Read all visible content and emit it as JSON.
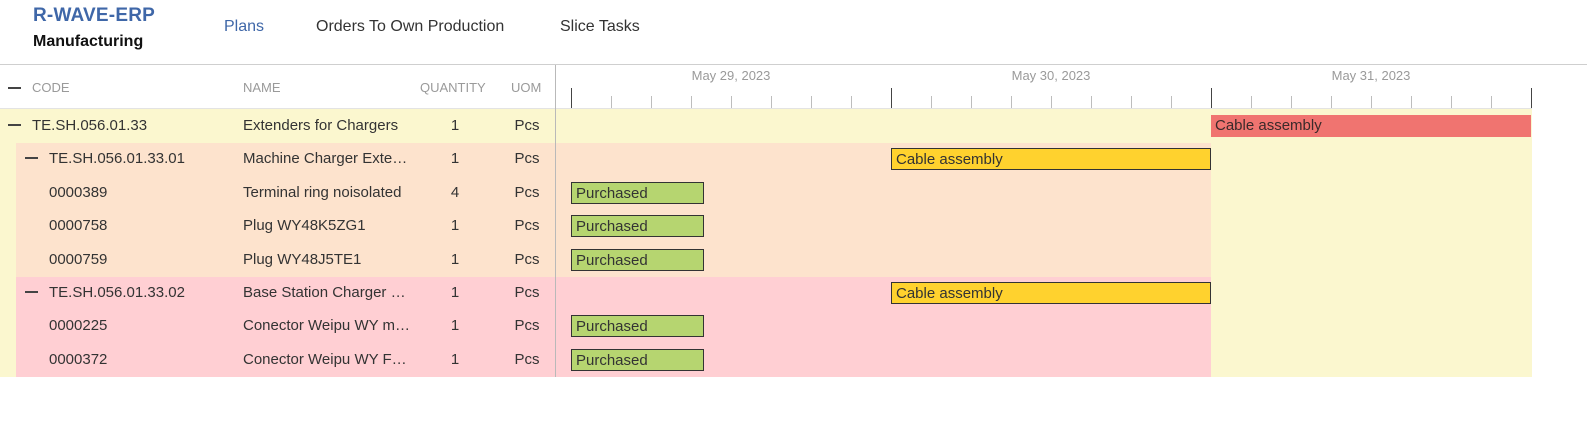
{
  "brand": {
    "title": "R-WAVE-ERP",
    "subtitle": "Manufacturing"
  },
  "nav": [
    {
      "label": "Plans",
      "active": true
    },
    {
      "label": "Orders To Own Production",
      "active": false
    },
    {
      "label": "Slice Tasks",
      "active": false
    }
  ],
  "grid": {
    "columns": {
      "code": "CODE",
      "name": "NAME",
      "quantity": "QUANTITY",
      "uom": "UOM"
    },
    "dates": [
      "May 29, 2023",
      "May 30, 2023",
      "May 31, 2023"
    ],
    "rows": [
      {
        "code": "TE.SH.056.01.33",
        "name": "Extenders for Chargers",
        "quantity": "1",
        "uom": "Pcs",
        "level": 0,
        "expandable": true,
        "bar": "Cable assembly",
        "color": "#f07470"
      },
      {
        "code": "TE.SH.056.01.33.01",
        "name": "Machine Charger Extender",
        "quantity": "1",
        "uom": "Pcs",
        "level": 1,
        "expandable": true,
        "bar": "Cable assembly",
        "color": "#ffd22e"
      },
      {
        "code": "0000389",
        "name": "Terminal ring noisolated",
        "quantity": "4",
        "uom": "Pcs",
        "level": 2,
        "expandable": false,
        "bar": "Purchased",
        "color": "#b6d570"
      },
      {
        "code": "0000758",
        "name": "Plug WY48K5ZG1",
        "quantity": "1",
        "uom": "Pcs",
        "level": 2,
        "expandable": false,
        "bar": "Purchased",
        "color": "#b6d570"
      },
      {
        "code": "0000759",
        "name": "Plug WY48J5TE1",
        "quantity": "1",
        "uom": "Pcs",
        "level": 2,
        "expandable": false,
        "bar": "Purchased",
        "color": "#b6d570"
      },
      {
        "code": "TE.SH.056.01.33.02",
        "name": "Base Station Charger Extender",
        "quantity": "1",
        "uom": "Pcs",
        "level": 1,
        "expandable": true,
        "bar": "Cable assembly",
        "color": "#ffd22e"
      },
      {
        "code": "0000225",
        "name": "Conector Weipu WY male",
        "quantity": "1",
        "uom": "Pcs",
        "level": 2,
        "expandable": false,
        "bar": "Purchased",
        "color": "#b6d570"
      },
      {
        "code": "0000372",
        "name": "Conector Weipu WY Female",
        "quantity": "1",
        "uom": "Pcs",
        "level": 2,
        "expandable": false,
        "bar": "Purchased",
        "color": "#b6d570"
      }
    ]
  }
}
